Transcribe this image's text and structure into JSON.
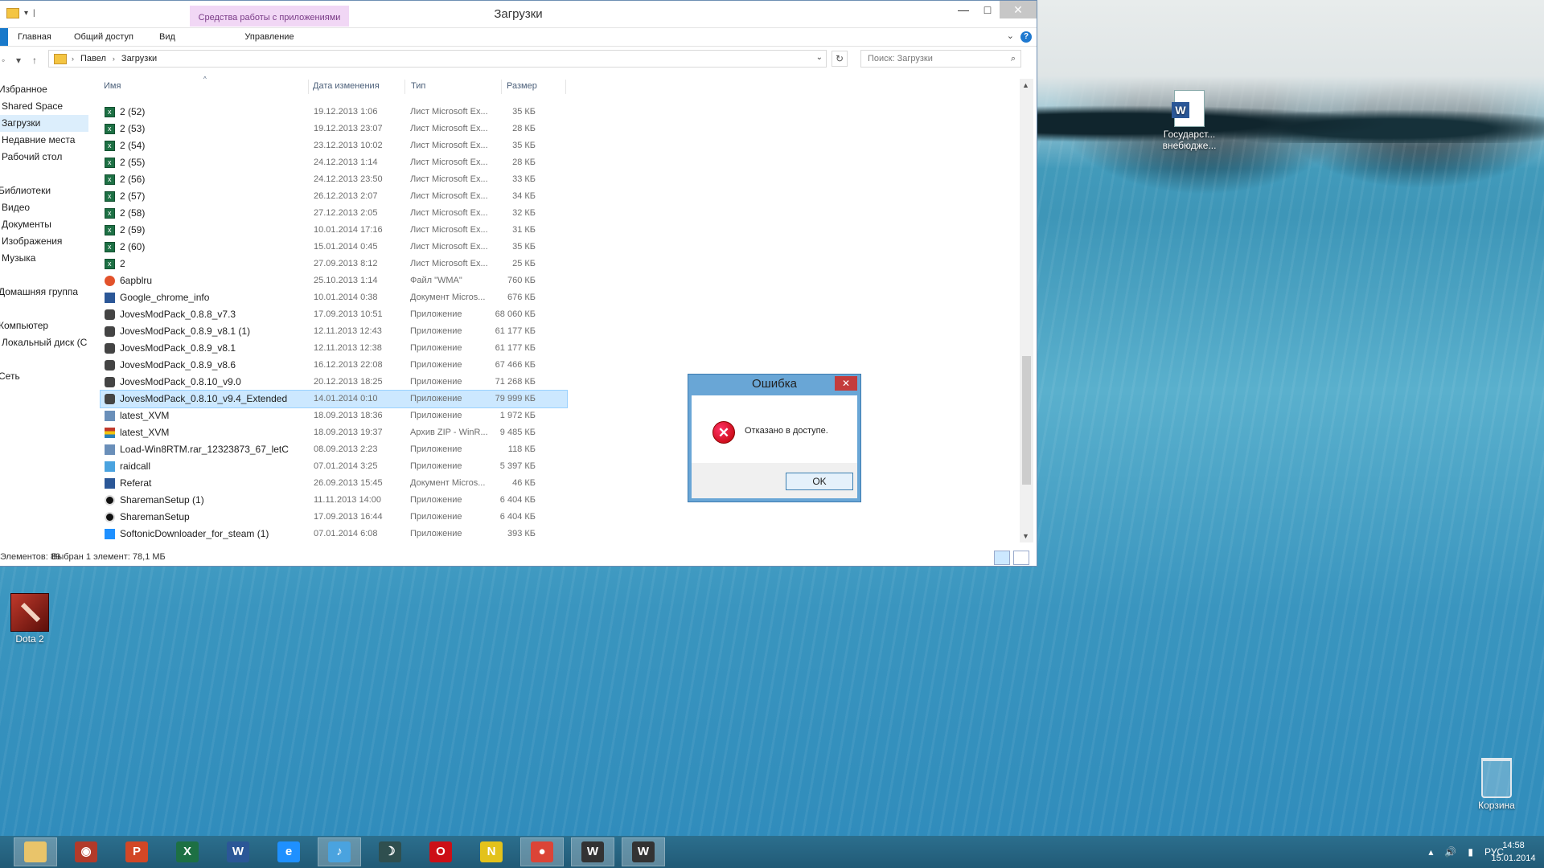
{
  "window": {
    "title": "Загрузки",
    "context_tools": "Средства работы с приложениями",
    "qat_sep": "|",
    "controls": {
      "minimize": "—",
      "maximize": "□",
      "close": "✕"
    },
    "tabs": {
      "home": "Главная",
      "share": "Общий доступ",
      "view": "Вид",
      "manage": "Управление"
    },
    "help": "?"
  },
  "address": {
    "segments": [
      "Павел",
      "Загрузки"
    ],
    "search_placeholder": "Поиск: Загрузки"
  },
  "navpane": [
    {
      "label": "Избранное",
      "group": true
    },
    {
      "label": "Shared Space"
    },
    {
      "label": "Загрузки",
      "selected": true
    },
    {
      "label": "Недавние места"
    },
    {
      "label": "Рабочий стол"
    },
    {
      "label": ""
    },
    {
      "label": "Библиотеки",
      "group": true
    },
    {
      "label": "Видео"
    },
    {
      "label": "Документы"
    },
    {
      "label": "Изображения"
    },
    {
      "label": "Музыка"
    },
    {
      "label": ""
    },
    {
      "label": "Домашняя группа",
      "group": true
    },
    {
      "label": ""
    },
    {
      "label": "Компьютер",
      "group": true
    },
    {
      "label": "Локальный диск (C"
    },
    {
      "label": ""
    },
    {
      "label": "Сеть",
      "group": true
    }
  ],
  "columns": {
    "name": "Имя",
    "date": "Дата изменения",
    "type": "Тип",
    "size": "Размер"
  },
  "files": [
    {
      "icon": "xls",
      "name": "2 (52)",
      "date": "19.12.2013 1:06",
      "type": "Лист Microsoft Ex...",
      "size": "35 КБ"
    },
    {
      "icon": "xls",
      "name": "2 (53)",
      "date": "19.12.2013 23:07",
      "type": "Лист Microsoft Ex...",
      "size": "28 КБ"
    },
    {
      "icon": "xls",
      "name": "2 (54)",
      "date": "23.12.2013 10:02",
      "type": "Лист Microsoft Ex...",
      "size": "35 КБ"
    },
    {
      "icon": "xls",
      "name": "2 (55)",
      "date": "24.12.2013 1:14",
      "type": "Лист Microsoft Ex...",
      "size": "28 КБ"
    },
    {
      "icon": "xls",
      "name": "2 (56)",
      "date": "24.12.2013 23:50",
      "type": "Лист Microsoft Ex...",
      "size": "33 КБ"
    },
    {
      "icon": "xls",
      "name": "2 (57)",
      "date": "26.12.2013 2:07",
      "type": "Лист Microsoft Ex...",
      "size": "34 КБ"
    },
    {
      "icon": "xls",
      "name": "2 (58)",
      "date": "27.12.2013 2:05",
      "type": "Лист Microsoft Ex...",
      "size": "32 КБ"
    },
    {
      "icon": "xls",
      "name": "2 (59)",
      "date": "10.01.2014 17:16",
      "type": "Лист Microsoft Ex...",
      "size": "31 КБ"
    },
    {
      "icon": "xls",
      "name": "2 (60)",
      "date": "15.01.2014 0:45",
      "type": "Лист Microsoft Ex...",
      "size": "35 КБ"
    },
    {
      "icon": "xls",
      "name": "2",
      "date": "27.09.2013 8:12",
      "type": "Лист Microsoft Ex...",
      "size": "25 КБ"
    },
    {
      "icon": "wma",
      "name": "6apblru",
      "date": "25.10.2013 1:14",
      "type": "Файл \"WMA\"",
      "size": "760 КБ"
    },
    {
      "icon": "doc",
      "name": "Google_chrome_info",
      "date": "10.01.2014 0:38",
      "type": "Документ Micros...",
      "size": "676 КБ"
    },
    {
      "icon": "app",
      "name": "JovesModPack_0.8.8_v7.3",
      "date": "17.09.2013 10:51",
      "type": "Приложение",
      "size": "68 060 КБ"
    },
    {
      "icon": "app",
      "name": "JovesModPack_0.8.9_v8.1 (1)",
      "date": "12.11.2013 12:43",
      "type": "Приложение",
      "size": "61 177 КБ"
    },
    {
      "icon": "app",
      "name": "JovesModPack_0.8.9_v8.1",
      "date": "12.11.2013 12:38",
      "type": "Приложение",
      "size": "61 177 КБ"
    },
    {
      "icon": "app",
      "name": "JovesModPack_0.8.9_v8.6",
      "date": "16.12.2013 22:08",
      "type": "Приложение",
      "size": "67 466 КБ"
    },
    {
      "icon": "app",
      "name": "JovesModPack_0.8.10_v9.0",
      "date": "20.12.2013 18:25",
      "type": "Приложение",
      "size": "71 268 КБ"
    },
    {
      "icon": "app",
      "name": "JovesModPack_0.8.10_v9.4_Extended",
      "date": "14.01.2014 0:10",
      "type": "Приложение",
      "size": "79 999 КБ",
      "selected": true
    },
    {
      "icon": "xvm",
      "name": "latest_XVM",
      "date": "18.09.2013 18:36",
      "type": "Приложение",
      "size": "1 972 КБ"
    },
    {
      "icon": "zip",
      "name": "latest_XVM",
      "date": "18.09.2013 19:37",
      "type": "Архив ZIP - WinR...",
      "size": "9 485 КБ"
    },
    {
      "icon": "xvm",
      "name": "Load-Win8RTM.rar_12323873_67_letC",
      "date": "08.09.2013 2:23",
      "type": "Приложение",
      "size": "118 КБ"
    },
    {
      "icon": "raid",
      "name": "raidcall",
      "date": "07.01.2014 3:25",
      "type": "Приложение",
      "size": "5 397 КБ"
    },
    {
      "icon": "doc",
      "name": "Referat",
      "date": "26.09.2013 15:45",
      "type": "Документ Micros...",
      "size": "46 КБ"
    },
    {
      "icon": "share",
      "name": "SharemanSetup (1)",
      "date": "11.11.2013 14:00",
      "type": "Приложение",
      "size": "6 404 КБ"
    },
    {
      "icon": "share",
      "name": "SharemanSetup",
      "date": "17.09.2013 16:44",
      "type": "Приложение",
      "size": "6 404 КБ"
    },
    {
      "icon": "soft",
      "name": "SoftonicDownloader_for_steam (1)",
      "date": "07.01.2014 6:08",
      "type": "Приложение",
      "size": "393 КБ"
    }
  ],
  "status": {
    "count": "Элементов: 89",
    "selection": "Выбран 1 элемент: 78,1 МБ"
  },
  "dialog": {
    "title": "Ошибка",
    "message": "Отказано в доступе.",
    "ok": "OK",
    "close": "✕",
    "icon_mark": "✕"
  },
  "desktop": {
    "word_doc": "Государст... внебюдже...",
    "dota": "Dota 2",
    "bin": "Корзина"
  },
  "taskbar": {
    "apps": [
      {
        "name": "explorer",
        "glyph": "",
        "color": "#e9c46a",
        "active": true
      },
      {
        "name": "game-client",
        "glyph": "◉",
        "color": "#b23a2a"
      },
      {
        "name": "powerpoint",
        "glyph": "P",
        "color": "#d24726"
      },
      {
        "name": "excel",
        "glyph": "X",
        "color": "#1d7044"
      },
      {
        "name": "word",
        "glyph": "W",
        "color": "#2b5797"
      },
      {
        "name": "internet-explorer",
        "glyph": "e",
        "color": "#1e90ff"
      },
      {
        "name": "music-app",
        "glyph": "♪",
        "color": "#4aa3df",
        "active": true
      },
      {
        "name": "moon-app",
        "glyph": "☽",
        "color": "#2f4f4f"
      },
      {
        "name": "opera",
        "glyph": "O",
        "color": "#cc0f16"
      },
      {
        "name": "navi-app",
        "glyph": "N",
        "color": "#e3c21b"
      },
      {
        "name": "chrome",
        "glyph": "●",
        "color": "#db4437",
        "active": true
      },
      {
        "name": "world-of-tanks",
        "glyph": "W",
        "color": "#333",
        "active": true
      },
      {
        "name": "world-of-tanks-2",
        "glyph": "W",
        "color": "#333",
        "active": true
      }
    ],
    "lang": "РУС",
    "time": "14:58",
    "date": "15.01.2014"
  }
}
